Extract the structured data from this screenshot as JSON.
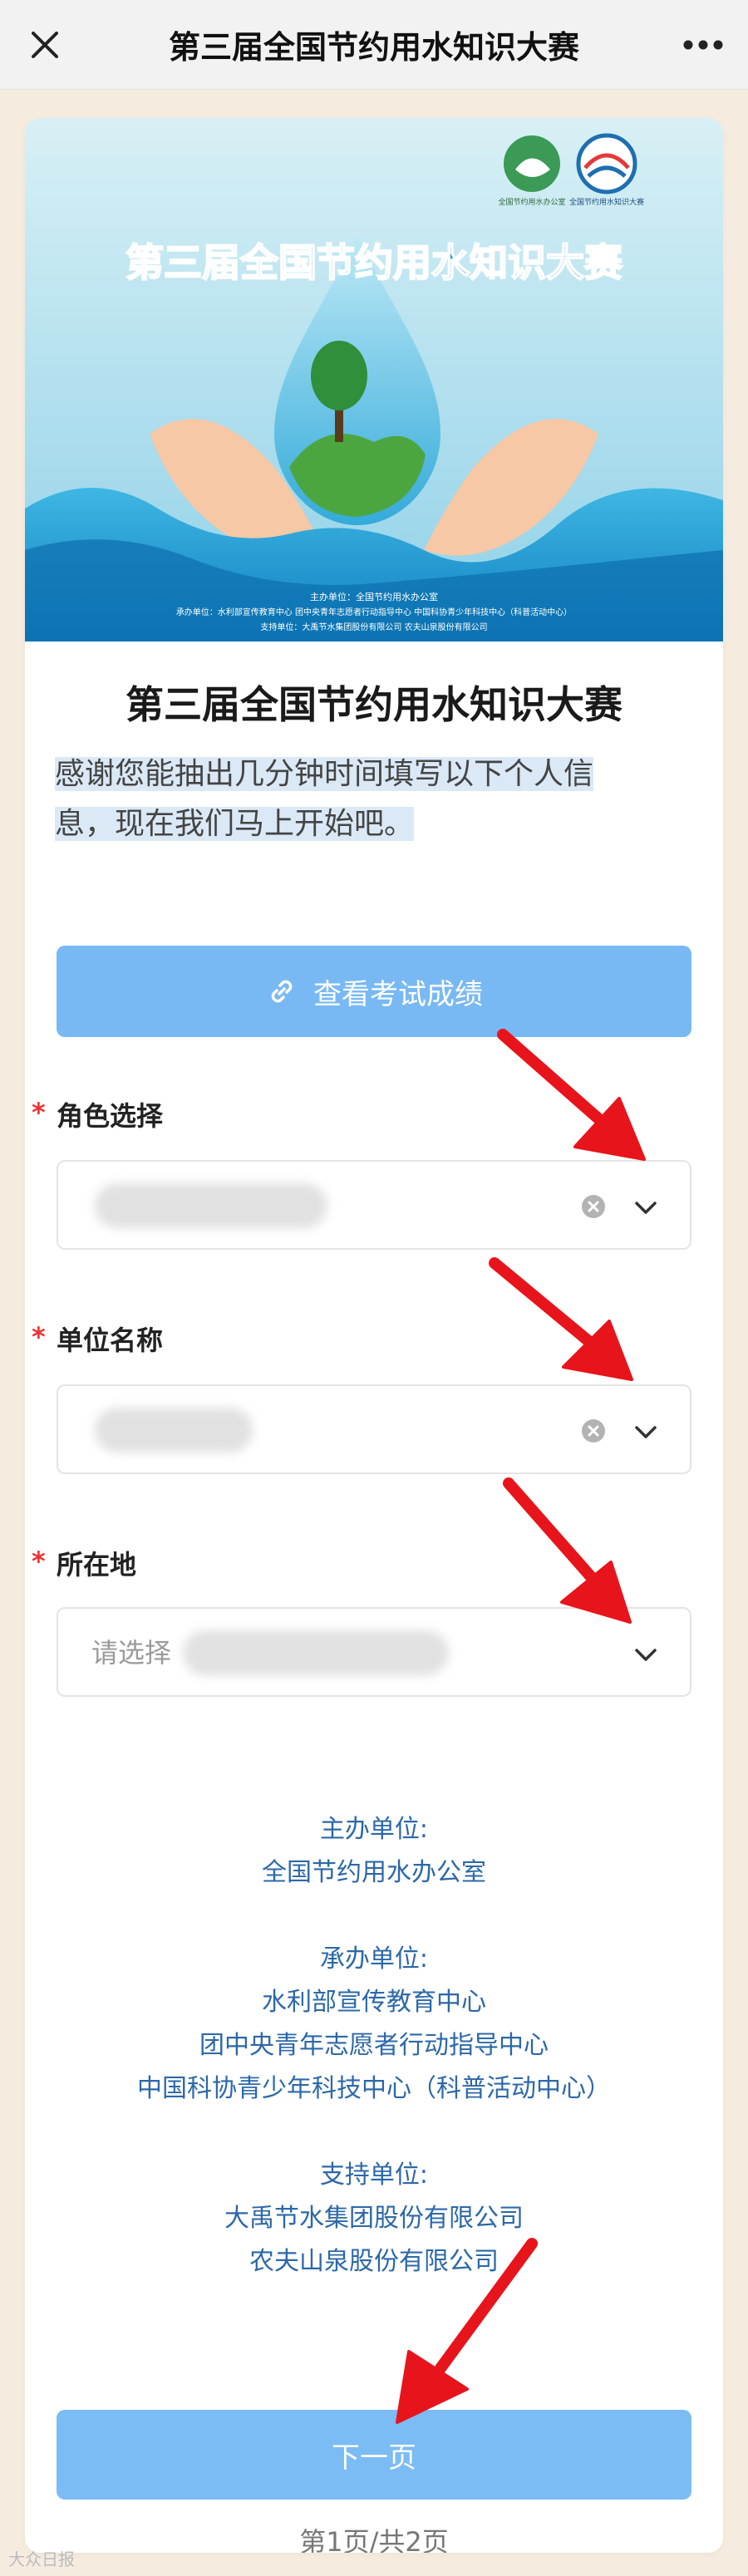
{
  "navbar": {
    "title": "第三届全国节约用水知识大赛"
  },
  "banner": {
    "headline": "第三届全国节约用水知识大赛",
    "logo_left_text": "全国节约用水办公室",
    "logo_right_text": "全国节约用水知识大赛",
    "footer_line1": "主办单位：全国节约用水办公室",
    "footer_line2": "承办单位：水利部宣传教育中心    团中央青年志愿者行动指导中心    中国科协青少年科技中心（科普活动中心）",
    "footer_line3": "支持单位：大禹节水集团股份有限公司    农夫山泉股份有限公司"
  },
  "form": {
    "title": "第三届全国节约用水知识大赛",
    "desc_line1": "感谢您能抽出几分钟时间填写以下个人信",
    "desc_line2": "息，现在我们马上开始吧。",
    "score_button": "查看考试成绩",
    "fields": [
      {
        "label": "角色选择",
        "required": "*",
        "value": ""
      },
      {
        "label": "单位名称",
        "required": "*",
        "value": ""
      },
      {
        "label": "所在地",
        "required": "*",
        "value": "请选择"
      }
    ]
  },
  "organizers": {
    "host_label": "主办单位:",
    "host": "全国节约用水办公室",
    "undertake_label": "承办单位:",
    "undertake_1": "水利部宣传教育中心",
    "undertake_2": "团中央青年志愿者行动指导中心",
    "undertake_3": "中国科协青少年科技中心（科普活动中心）",
    "support_label": "支持单位:",
    "support_1": "大禹节水集团股份有限公司",
    "support_2": "农夫山泉股份有限公司"
  },
  "footer": {
    "next_button": "下一页",
    "page_indicator": "第1页/共2页",
    "watermark": "大众日报"
  },
  "colors": {
    "accent": "#79b9f3",
    "arrow": "#e8141b",
    "link_text": "#2c68a8",
    "required": "#e33333"
  }
}
